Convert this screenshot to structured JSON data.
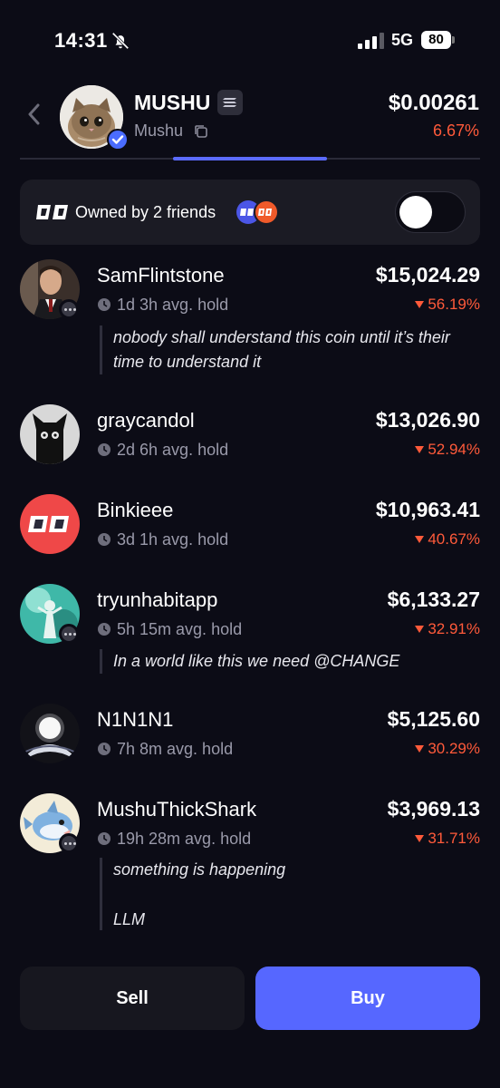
{
  "status_bar": {
    "time": "14:31",
    "network": "5G",
    "battery": "80"
  },
  "coin": {
    "name": "MUSHU",
    "ticker": "Mushu",
    "price": "$0.00261",
    "change": "6.67%",
    "change_color": "#ff5a3a"
  },
  "friends": {
    "text": "Owned by 2 friends",
    "toggle_on": false
  },
  "holders": [
    {
      "name": "SamFlintstone",
      "hold": "1d 3h avg. hold",
      "value": "$15,024.29",
      "change": "56.19%",
      "comment": "nobody shall understand this coin until it’s their time to understand it"
    },
    {
      "name": "graycandol",
      "hold": "2d 6h avg. hold",
      "value": "$13,026.90",
      "change": "52.94%"
    },
    {
      "name": "Binkieee",
      "hold": "3d 1h avg. hold",
      "value": "$10,963.41",
      "change": "40.67%"
    },
    {
      "name": "tryunhabitapp",
      "hold": "5h 15m avg. hold",
      "value": "$6,133.27",
      "change": "32.91%",
      "comment": "In a world like this we need @CHANGE"
    },
    {
      "name": "N1N1N1",
      "hold": "7h 8m avg. hold",
      "value": "$5,125.60",
      "change": "30.29%"
    },
    {
      "name": "MushuThickShark",
      "hold": "19h 28m avg. hold",
      "value": "$3,969.13",
      "change": "31.71%",
      "comment_lines": [
        "something is happening",
        "LLM"
      ]
    }
  ],
  "actions": {
    "sell": "Sell",
    "buy": "Buy"
  },
  "colors": {
    "accent": "#5667ff",
    "negative": "#ff5a3a",
    "background": "#0c0c16"
  }
}
